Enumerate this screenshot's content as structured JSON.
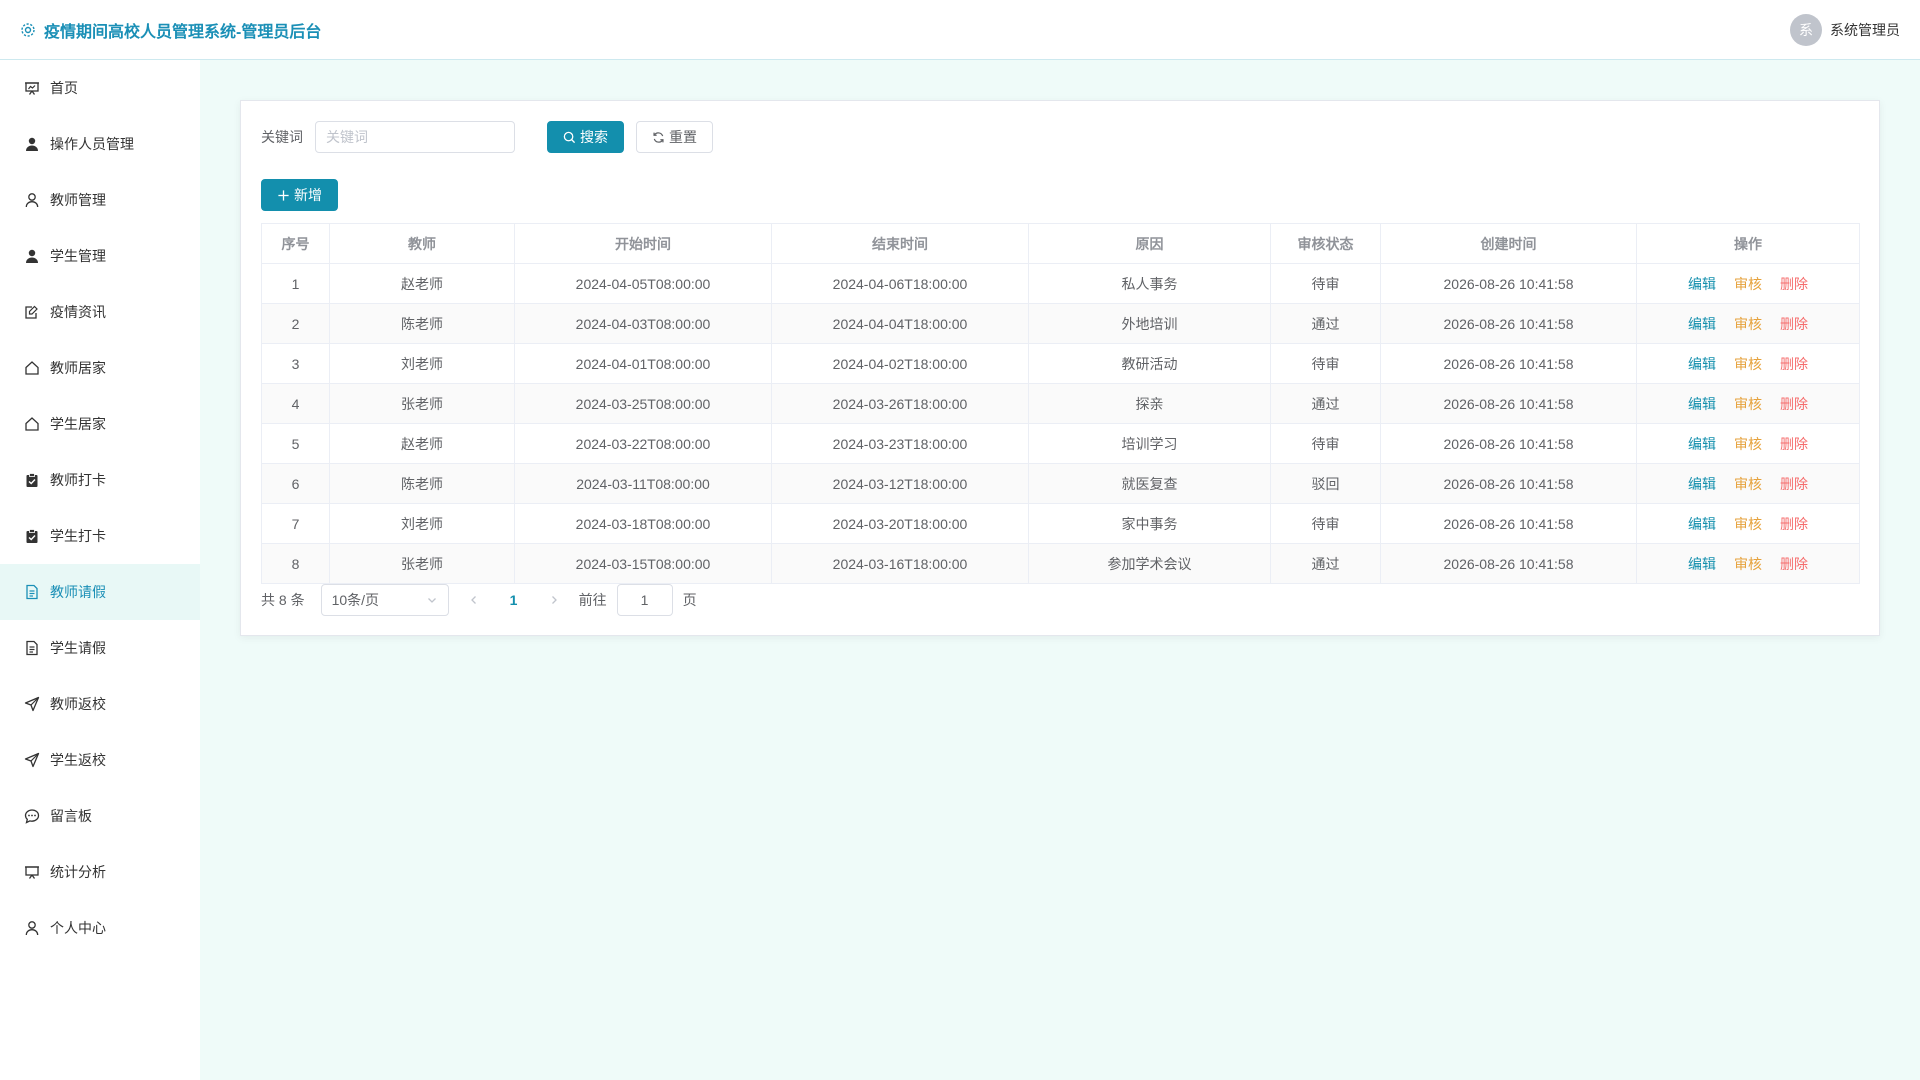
{
  "header": {
    "title": "疫情期间高校人员管理系统-管理员后台",
    "user_name": "系统管理员",
    "avatar_text": "系"
  },
  "sidebar": {
    "items": [
      {
        "label": "首页",
        "icon": "home-board-icon"
      },
      {
        "label": "操作人员管理",
        "icon": "user-filled-icon"
      },
      {
        "label": "教师管理",
        "icon": "user-icon"
      },
      {
        "label": "学生管理",
        "icon": "user-filled-icon"
      },
      {
        "label": "疫情资讯",
        "icon": "document-edit-icon"
      },
      {
        "label": "教师居家",
        "icon": "house-icon"
      },
      {
        "label": "学生居家",
        "icon": "house-icon"
      },
      {
        "label": "教师打卡",
        "icon": "clipboard-check-icon"
      },
      {
        "label": "学生打卡",
        "icon": "clipboard-check-icon"
      },
      {
        "label": "教师请假",
        "icon": "document-icon"
      },
      {
        "label": "学生请假",
        "icon": "document-icon"
      },
      {
        "label": "教师返校",
        "icon": "send-icon"
      },
      {
        "label": "学生返校",
        "icon": "send-icon"
      },
      {
        "label": "留言板",
        "icon": "chat-icon"
      },
      {
        "label": "统计分析",
        "icon": "presentation-icon"
      },
      {
        "label": "个人中心",
        "icon": "user-icon"
      }
    ],
    "active_index": 9
  },
  "search": {
    "label": "关键词",
    "placeholder": "关键词",
    "value": "",
    "search_label": "搜索",
    "reset_label": "重置"
  },
  "toolbar": {
    "add_label": "新增"
  },
  "table": {
    "headers": [
      "序号",
      "教师",
      "开始时间",
      "结束时间",
      "原因",
      "审核状态",
      "创建时间",
      "操作"
    ],
    "rows": [
      [
        "1",
        "赵老师",
        "2024-04-05T08:00:00",
        "2024-04-06T18:00:00",
        "私人事务",
        "待审",
        "2026-08-26 10:41:58"
      ],
      [
        "2",
        "陈老师",
        "2024-04-03T08:00:00",
        "2024-04-04T18:00:00",
        "外地培训",
        "通过",
        "2026-08-26 10:41:58"
      ],
      [
        "3",
        "刘老师",
        "2024-04-01T08:00:00",
        "2024-04-02T18:00:00",
        "教研活动",
        "待审",
        "2026-08-26 10:41:58"
      ],
      [
        "4",
        "张老师",
        "2024-03-25T08:00:00",
        "2024-03-26T18:00:00",
        "探亲",
        "通过",
        "2026-08-26 10:41:58"
      ],
      [
        "5",
        "赵老师",
        "2024-03-22T08:00:00",
        "2024-03-23T18:00:00",
        "培训学习",
        "待审",
        "2026-08-26 10:41:58"
      ],
      [
        "6",
        "陈老师",
        "2024-03-11T08:00:00",
        "2024-03-12T18:00:00",
        "就医复查",
        "驳回",
        "2026-08-26 10:41:58"
      ],
      [
        "7",
        "刘老师",
        "2024-03-18T08:00:00",
        "2024-03-20T18:00:00",
        "家中事务",
        "待审",
        "2026-08-26 10:41:58"
      ],
      [
        "8",
        "张老师",
        "2024-03-15T08:00:00",
        "2024-03-16T18:00:00",
        "参加学术会议",
        "通过",
        "2026-08-26 10:41:58"
      ]
    ],
    "actions": {
      "edit": "编辑",
      "audit": "审核",
      "delete": "删除"
    }
  },
  "pagination": {
    "total_text": "共 8 条",
    "page_size": "10条/页",
    "current_page": "1",
    "goto_prefix": "前往",
    "goto_value": "1",
    "goto_suffix": "页"
  },
  "colors": {
    "primary": "#138fad",
    "brand_text": "#1a8fb6",
    "warning": "#e6a23c",
    "danger": "#f56c6c",
    "background": "#effbf9"
  }
}
